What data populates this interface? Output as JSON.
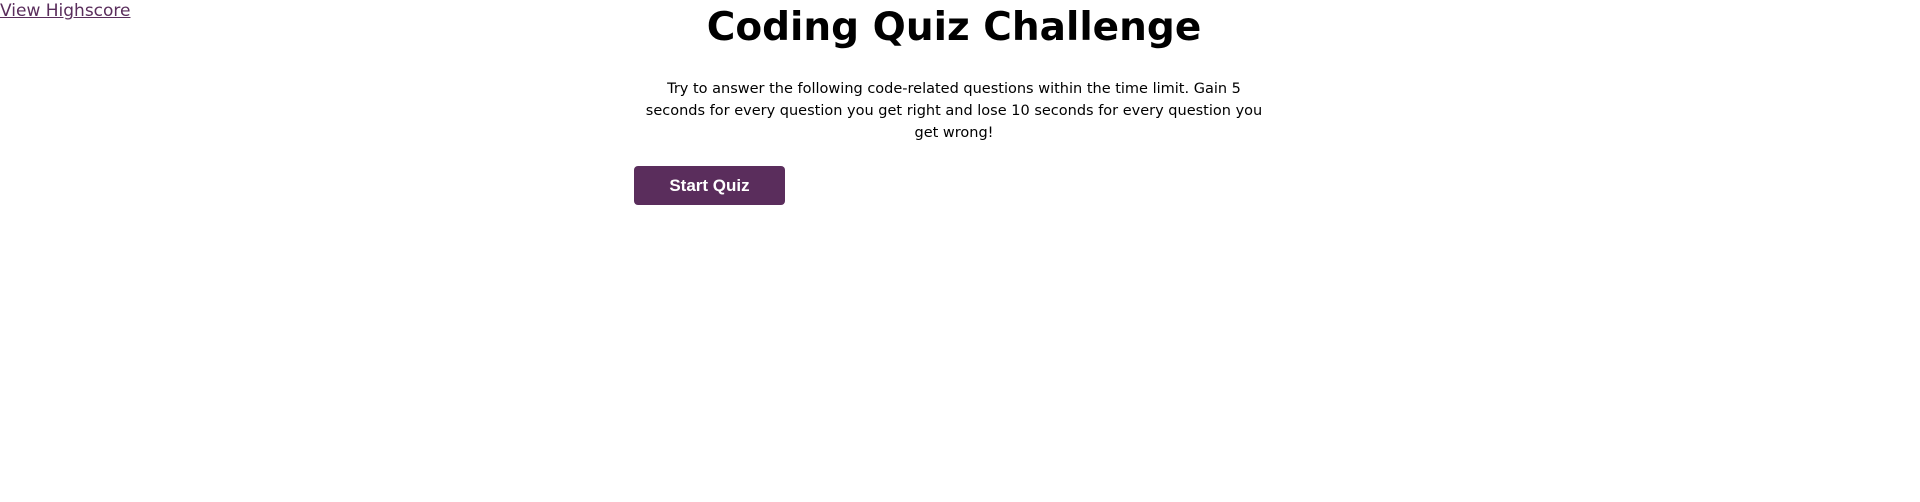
{
  "header": {
    "highscore_link": "View Highscore"
  },
  "quiz": {
    "title": "Coding Quiz Challenge",
    "instructions": "Try to answer the following code-related questions within the time limit. Gain 5 seconds for every question you get right and lose 10 seconds for every question you get wrong!",
    "start_label": "Start Quiz"
  },
  "colors": {
    "accent": "#5a2d5c",
    "button_text": "#ffffff",
    "background": "#ffffff"
  }
}
